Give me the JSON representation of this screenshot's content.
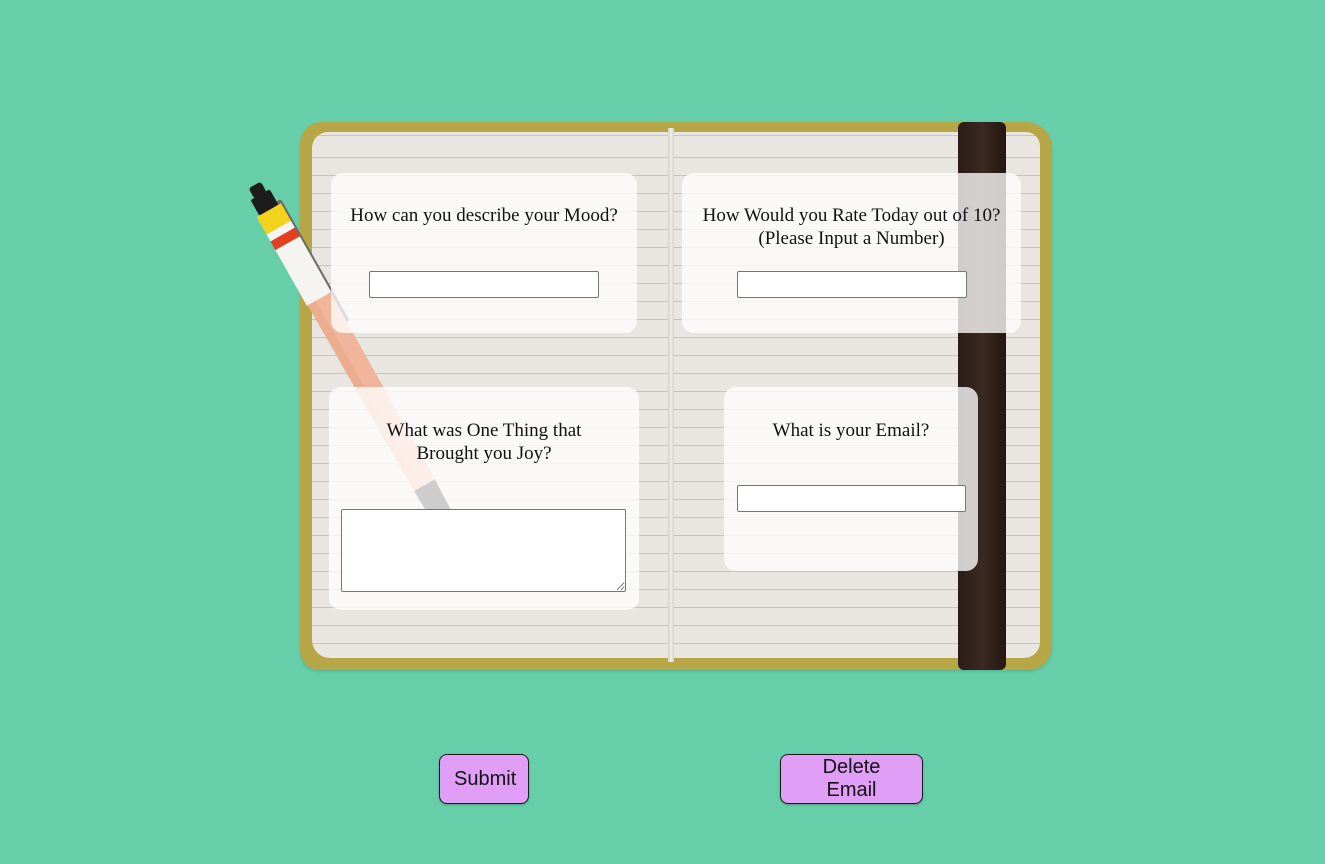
{
  "form": {
    "mood": {
      "question": "How can you describe your Mood?",
      "value": ""
    },
    "rating": {
      "question": "How Would you Rate Today out of 10? (Please Input a Number)",
      "value": ""
    },
    "joy": {
      "question": "What was One Thing that Brought you Joy?",
      "value": ""
    },
    "email": {
      "question": "What is your Email?",
      "value": ""
    }
  },
  "buttons": {
    "submit_label": "Submit",
    "delete_email_label": "Delete Email"
  },
  "colors": {
    "background": "#66cfaa",
    "button": "#e19ef7",
    "notebook_cover": "#b6a645",
    "strap": "#2f201a"
  },
  "illustration": {
    "icons": [
      "notebook-image",
      "pen-icon"
    ]
  }
}
